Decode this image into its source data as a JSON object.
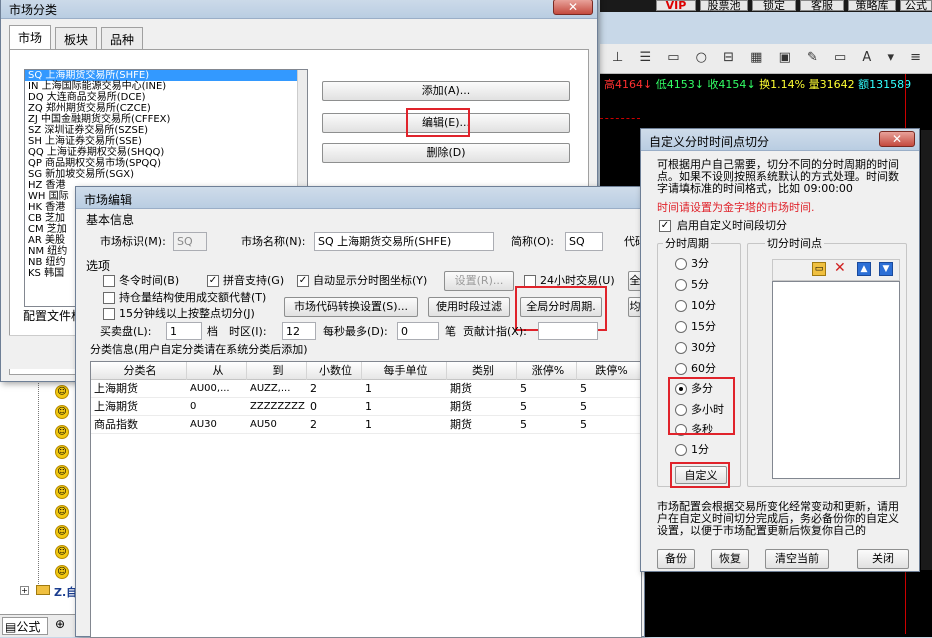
{
  "top_bar": {
    "buttons": [
      "VIP",
      "股票池",
      "锁定",
      "客服",
      "策略库",
      "公式"
    ]
  },
  "ticker": {
    "high": "高4164",
    "low": "低4153",
    "close": "收4154",
    "turnover": "换1.14%",
    "volume": "量31642",
    "amount": "额131589"
  },
  "market_window": {
    "title": "市场分类",
    "tabs": [
      "市场",
      "板块",
      "品种"
    ],
    "markets": [
      "SQ  上海期货交易所(SHFE)",
      "IN  上海国际能源交易中心(INE)",
      "DQ  大连商品交易所(DCE)",
      "ZQ  郑州期货交易所(CZCE)",
      "ZJ  中国金融期货交易所(CFFEX)",
      "SZ  深圳证券交易所(SZSE)",
      "SH  上海证券交易所(SSE)",
      "QQ  上海证券期权交易(SHQQ)",
      "QP  商品期权交易市场(SPQQ)",
      "SG  新加坡交易所(SGX)",
      "HZ  香港",
      "WH  国际",
      "HK  香港",
      "CB  芝加",
      "CM  芝加",
      "AR  美股",
      "NM  纽约",
      "NB  纽约",
      "KS  韩国"
    ],
    "buttons": {
      "add": "添加(A)...",
      "edit": "编辑(E)...",
      "delete": "删除(D)"
    },
    "config_label": "配置文件格"
  },
  "market_edit": {
    "title": "市场编辑",
    "basic_info": "基本信息",
    "market_id_label": "市场标识(M):",
    "market_id_value": "SQ",
    "market_name_label": "市场名称(N):",
    "market_name_value": "SQ 上海期货交易所(SHFE)",
    "abbr_label": "简称(O):",
    "abbr_value": "SQ",
    "code_label": "代码",
    "options": "选项",
    "summer_time": "冬令时间(B)",
    "pinyin": "拼音支持(G)",
    "auto_axis": "自动显示分时图坐标(Y)",
    "settings_btn": "设置(R)...",
    "h24": "24小时交易(U)",
    "quan": "全",
    "hold_volume": "持仓量结构使用成交额代替(T)",
    "code_convert_btn": "市场代码转换设置(S)...",
    "period_filter_btn": "使用时段过滤",
    "global_period_btn": "全局分时周期.",
    "gc_btn": "均",
    "min15": "15分钟线以上按整点切分(J)",
    "buy_sell_label": "买卖盘(L):",
    "buy_sell_value": "1",
    "dang_label": "档",
    "tz_label": "时区(I):",
    "tz_value": "12",
    "max_per_sec_label": "每秒最多(D):",
    "max_per_sec_value": "0",
    "bi_label": "笔",
    "contrib_label": "贡献计指(X):",
    "category_info": "分类信息(用户自定分类请在系统分类后添加)",
    "columns": [
      "分类名",
      "从",
      "到",
      "小数位",
      "每手单位",
      "类别",
      "涨停%",
      "跌停%"
    ],
    "rows": [
      [
        "上海期货",
        "AU00,...",
        "AUZZ,...",
        "2",
        "1",
        "期货",
        "5",
        "5"
      ],
      [
        "上海期货",
        "0",
        "ZZZZZZZZ",
        "0",
        "1",
        "期货",
        "5",
        "5"
      ],
      [
        "商品指数",
        "AU30",
        "AU50",
        "2",
        "1",
        "期货",
        "5",
        "5"
      ]
    ]
  },
  "custom_dialog": {
    "title": "自定义分时时间点切分",
    "desc": "可根据用户自己需要，切分不同的分时周期的时间点。如果不设则按照系统默认的方式处理。时间数字请填标准的时间格式，比如 09:00:00",
    "red_note": "时间请设置为金字塔的市场时间.",
    "enable_label": "启用自定义时间段切分",
    "period_group": "分时周期",
    "points_group": "切分时间点",
    "periods": [
      "3分",
      "5分",
      "10分",
      "15分",
      "30分",
      "60分",
      "多分",
      "多小时",
      "多秒",
      "1分"
    ],
    "selected": "多分",
    "custom_btn": "自定义",
    "footer_note": "市场配置会根据交易所变化经常变动和更新，请用户在自定义时间切分完成后，务必备份你的自定义设置，以便于市场配置更新后恢复你自己的",
    "buttons": [
      "备份",
      "恢复",
      "清空当前",
      "关闭"
    ]
  },
  "bottom": {
    "formula_tab": "公式",
    "tree_item": "Z.自"
  },
  "colors": {
    "accent_red": "#e0232b",
    "ticker_red": "#ff3030",
    "ticker_green": "#33ff66",
    "ticker_yellow": "#ffff33",
    "ticker_cyan": "#33ffff"
  }
}
